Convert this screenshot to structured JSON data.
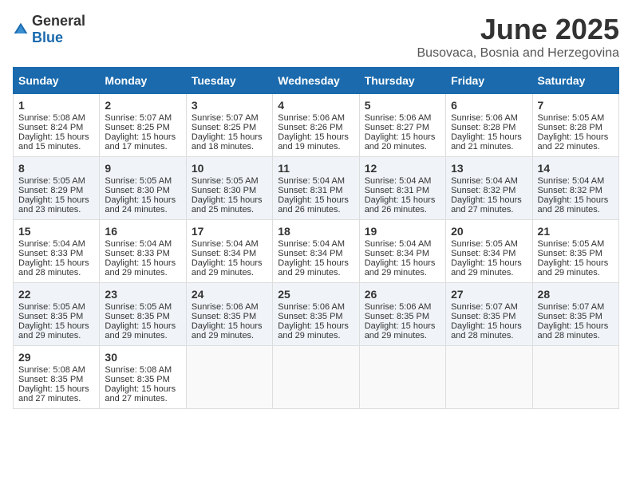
{
  "logo": {
    "text_general": "General",
    "text_blue": "Blue"
  },
  "title": "June 2025",
  "subtitle": "Busovaca, Bosnia and Herzegovina",
  "days_header": [
    "Sunday",
    "Monday",
    "Tuesday",
    "Wednesday",
    "Thursday",
    "Friday",
    "Saturday"
  ],
  "weeks": [
    [
      {
        "day": "1",
        "lines": [
          "Sunrise: 5:08 AM",
          "Sunset: 8:24 PM",
          "Daylight: 15 hours",
          "and 15 minutes."
        ]
      },
      {
        "day": "2",
        "lines": [
          "Sunrise: 5:07 AM",
          "Sunset: 8:25 PM",
          "Daylight: 15 hours",
          "and 17 minutes."
        ]
      },
      {
        "day": "3",
        "lines": [
          "Sunrise: 5:07 AM",
          "Sunset: 8:25 PM",
          "Daylight: 15 hours",
          "and 18 minutes."
        ]
      },
      {
        "day": "4",
        "lines": [
          "Sunrise: 5:06 AM",
          "Sunset: 8:26 PM",
          "Daylight: 15 hours",
          "and 19 minutes."
        ]
      },
      {
        "day": "5",
        "lines": [
          "Sunrise: 5:06 AM",
          "Sunset: 8:27 PM",
          "Daylight: 15 hours",
          "and 20 minutes."
        ]
      },
      {
        "day": "6",
        "lines": [
          "Sunrise: 5:06 AM",
          "Sunset: 8:28 PM",
          "Daylight: 15 hours",
          "and 21 minutes."
        ]
      },
      {
        "day": "7",
        "lines": [
          "Sunrise: 5:05 AM",
          "Sunset: 8:28 PM",
          "Daylight: 15 hours",
          "and 22 minutes."
        ]
      }
    ],
    [
      {
        "day": "8",
        "lines": [
          "Sunrise: 5:05 AM",
          "Sunset: 8:29 PM",
          "Daylight: 15 hours",
          "and 23 minutes."
        ]
      },
      {
        "day": "9",
        "lines": [
          "Sunrise: 5:05 AM",
          "Sunset: 8:30 PM",
          "Daylight: 15 hours",
          "and 24 minutes."
        ]
      },
      {
        "day": "10",
        "lines": [
          "Sunrise: 5:05 AM",
          "Sunset: 8:30 PM",
          "Daylight: 15 hours",
          "and 25 minutes."
        ]
      },
      {
        "day": "11",
        "lines": [
          "Sunrise: 5:04 AM",
          "Sunset: 8:31 PM",
          "Daylight: 15 hours",
          "and 26 minutes."
        ]
      },
      {
        "day": "12",
        "lines": [
          "Sunrise: 5:04 AM",
          "Sunset: 8:31 PM",
          "Daylight: 15 hours",
          "and 26 minutes."
        ]
      },
      {
        "day": "13",
        "lines": [
          "Sunrise: 5:04 AM",
          "Sunset: 8:32 PM",
          "Daylight: 15 hours",
          "and 27 minutes."
        ]
      },
      {
        "day": "14",
        "lines": [
          "Sunrise: 5:04 AM",
          "Sunset: 8:32 PM",
          "Daylight: 15 hours",
          "and 28 minutes."
        ]
      }
    ],
    [
      {
        "day": "15",
        "lines": [
          "Sunrise: 5:04 AM",
          "Sunset: 8:33 PM",
          "Daylight: 15 hours",
          "and 28 minutes."
        ]
      },
      {
        "day": "16",
        "lines": [
          "Sunrise: 5:04 AM",
          "Sunset: 8:33 PM",
          "Daylight: 15 hours",
          "and 29 minutes."
        ]
      },
      {
        "day": "17",
        "lines": [
          "Sunrise: 5:04 AM",
          "Sunset: 8:34 PM",
          "Daylight: 15 hours",
          "and 29 minutes."
        ]
      },
      {
        "day": "18",
        "lines": [
          "Sunrise: 5:04 AM",
          "Sunset: 8:34 PM",
          "Daylight: 15 hours",
          "and 29 minutes."
        ]
      },
      {
        "day": "19",
        "lines": [
          "Sunrise: 5:04 AM",
          "Sunset: 8:34 PM",
          "Daylight: 15 hours",
          "and 29 minutes."
        ]
      },
      {
        "day": "20",
        "lines": [
          "Sunrise: 5:05 AM",
          "Sunset: 8:34 PM",
          "Daylight: 15 hours",
          "and 29 minutes."
        ]
      },
      {
        "day": "21",
        "lines": [
          "Sunrise: 5:05 AM",
          "Sunset: 8:35 PM",
          "Daylight: 15 hours",
          "and 29 minutes."
        ]
      }
    ],
    [
      {
        "day": "22",
        "lines": [
          "Sunrise: 5:05 AM",
          "Sunset: 8:35 PM",
          "Daylight: 15 hours",
          "and 29 minutes."
        ]
      },
      {
        "day": "23",
        "lines": [
          "Sunrise: 5:05 AM",
          "Sunset: 8:35 PM",
          "Daylight: 15 hours",
          "and 29 minutes."
        ]
      },
      {
        "day": "24",
        "lines": [
          "Sunrise: 5:06 AM",
          "Sunset: 8:35 PM",
          "Daylight: 15 hours",
          "and 29 minutes."
        ]
      },
      {
        "day": "25",
        "lines": [
          "Sunrise: 5:06 AM",
          "Sunset: 8:35 PM",
          "Daylight: 15 hours",
          "and 29 minutes."
        ]
      },
      {
        "day": "26",
        "lines": [
          "Sunrise: 5:06 AM",
          "Sunset: 8:35 PM",
          "Daylight: 15 hours",
          "and 29 minutes."
        ]
      },
      {
        "day": "27",
        "lines": [
          "Sunrise: 5:07 AM",
          "Sunset: 8:35 PM",
          "Daylight: 15 hours",
          "and 28 minutes."
        ]
      },
      {
        "day": "28",
        "lines": [
          "Sunrise: 5:07 AM",
          "Sunset: 8:35 PM",
          "Daylight: 15 hours",
          "and 28 minutes."
        ]
      }
    ],
    [
      {
        "day": "29",
        "lines": [
          "Sunrise: 5:08 AM",
          "Sunset: 8:35 PM",
          "Daylight: 15 hours",
          "and 27 minutes."
        ]
      },
      {
        "day": "30",
        "lines": [
          "Sunrise: 5:08 AM",
          "Sunset: 8:35 PM",
          "Daylight: 15 hours",
          "and 27 minutes."
        ]
      },
      null,
      null,
      null,
      null,
      null
    ]
  ]
}
